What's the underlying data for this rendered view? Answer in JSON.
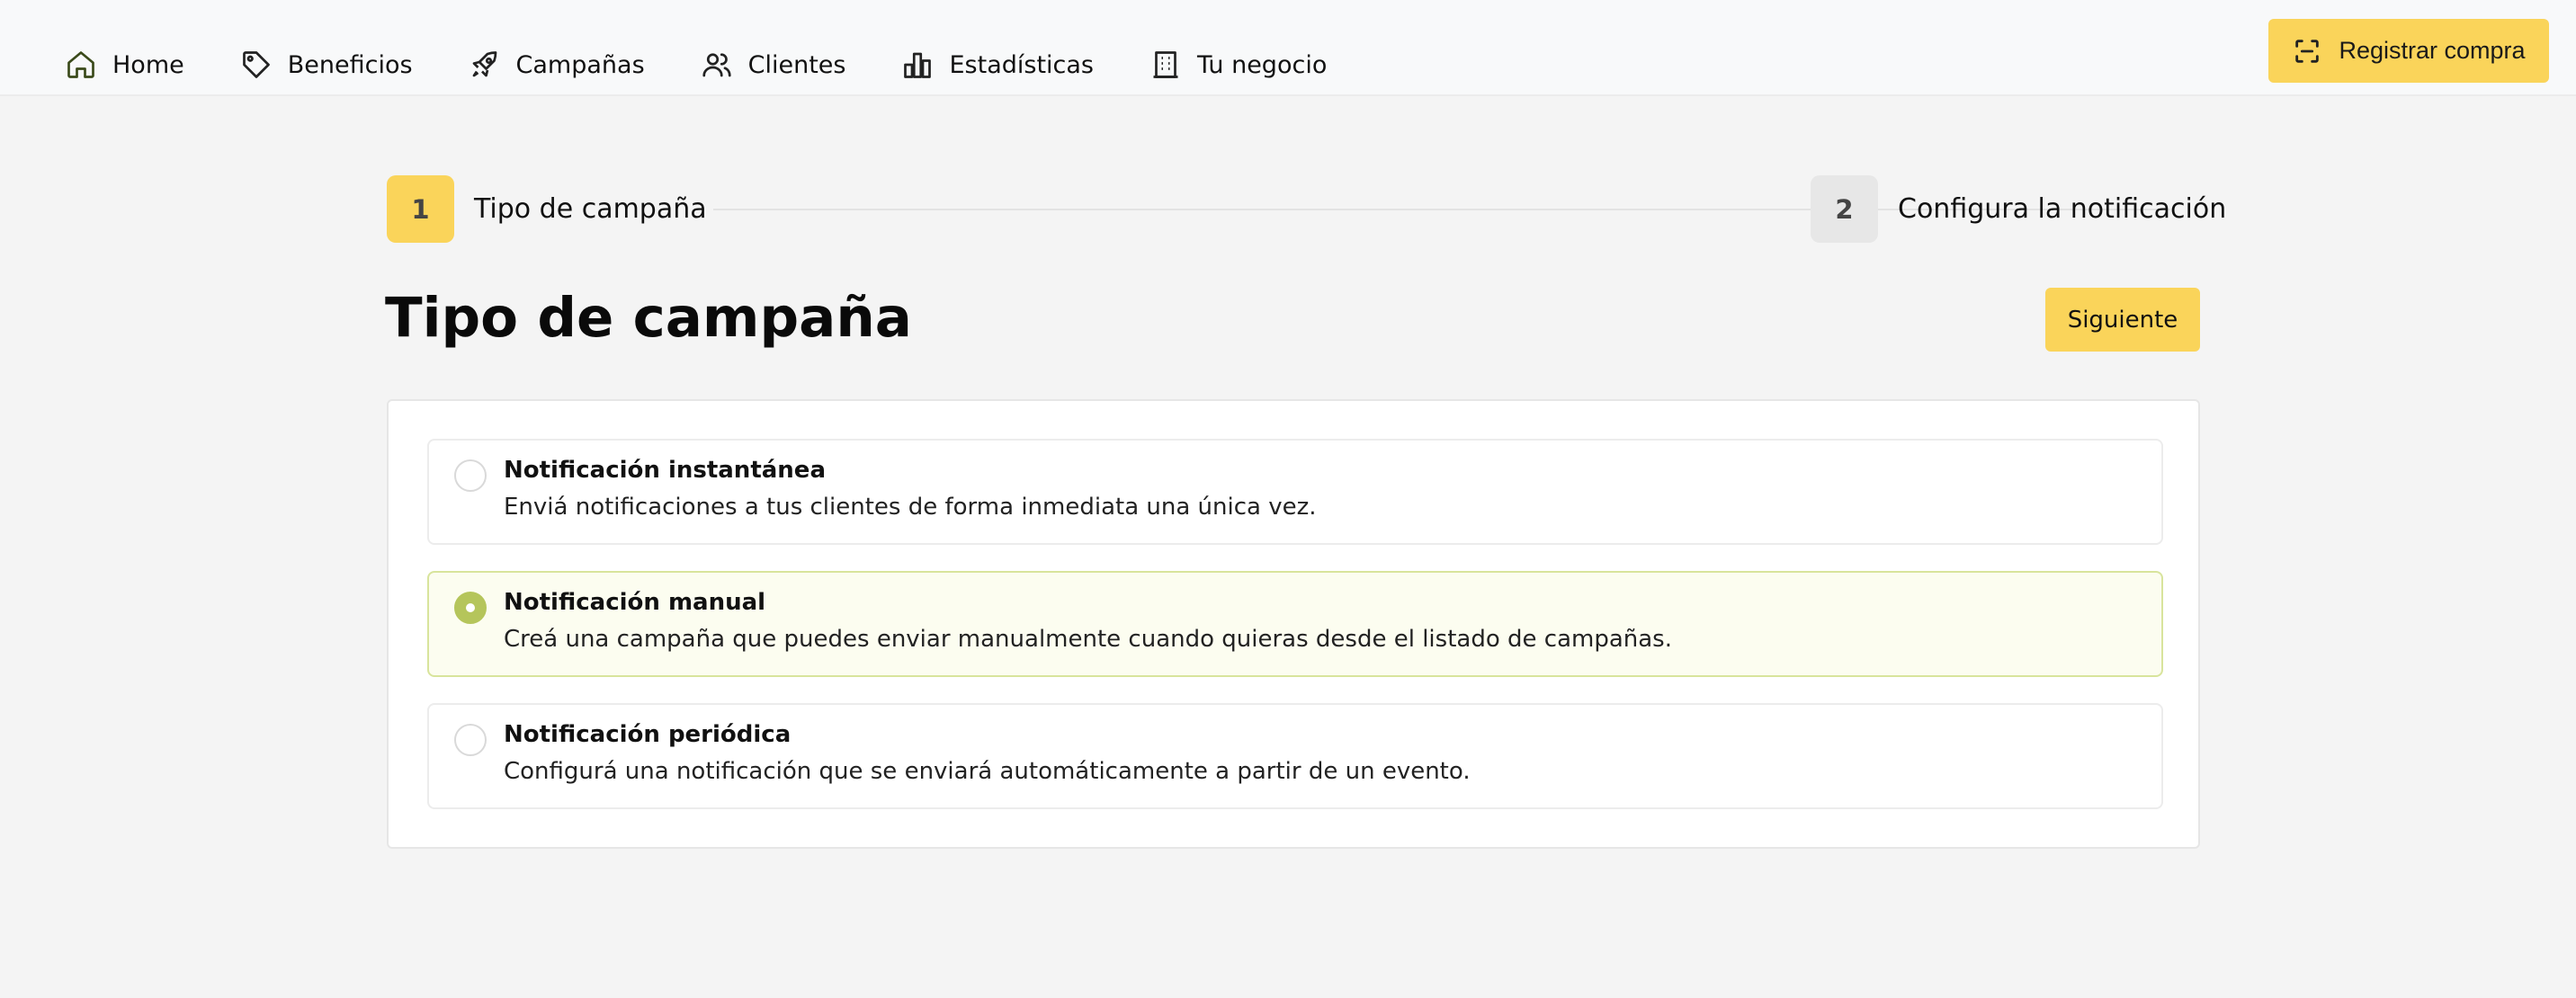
{
  "nav": {
    "items": [
      {
        "label": "Home",
        "icon": "home-icon"
      },
      {
        "label": "Beneficios",
        "icon": "tag-icon"
      },
      {
        "label": "Campañas",
        "icon": "rocket-icon"
      },
      {
        "label": "Clientes",
        "icon": "users-icon"
      },
      {
        "label": "Estadísticas",
        "icon": "bar-chart-icon"
      },
      {
        "label": "Tu negocio",
        "icon": "building-icon"
      }
    ],
    "active_icon_color": "#3a4a1a"
  },
  "header": {
    "register_label": "Registrar compra",
    "register_icon": "scan-icon"
  },
  "stepper": {
    "steps": [
      {
        "number": "1",
        "label": "Tipo de campaña",
        "state": "active"
      },
      {
        "number": "2",
        "label": "Configura la notificación",
        "state": "inactive"
      }
    ]
  },
  "main": {
    "title": "Tipo de campaña",
    "next_label": "Siguiente"
  },
  "options": [
    {
      "title": "Notificación instantánea",
      "description": "Enviá notificaciones a tus clientes de forma inmediata una única vez.",
      "selected": false
    },
    {
      "title": "Notificación manual",
      "description": "Creá una campaña que puedes enviar manualmente cuando quieras desde el listado de campañas.",
      "selected": true
    },
    {
      "title": "Notificación periódica",
      "description": "Configurá una notificación que se enviará automáticamente a partir de un evento.",
      "selected": false
    }
  ],
  "colors": {
    "accent": "#fad45a",
    "selected_radio": "#b5c55b",
    "selected_bg": "#fcfdf0",
    "selected_border": "#d8e49c",
    "background": "#f4f4f4"
  }
}
